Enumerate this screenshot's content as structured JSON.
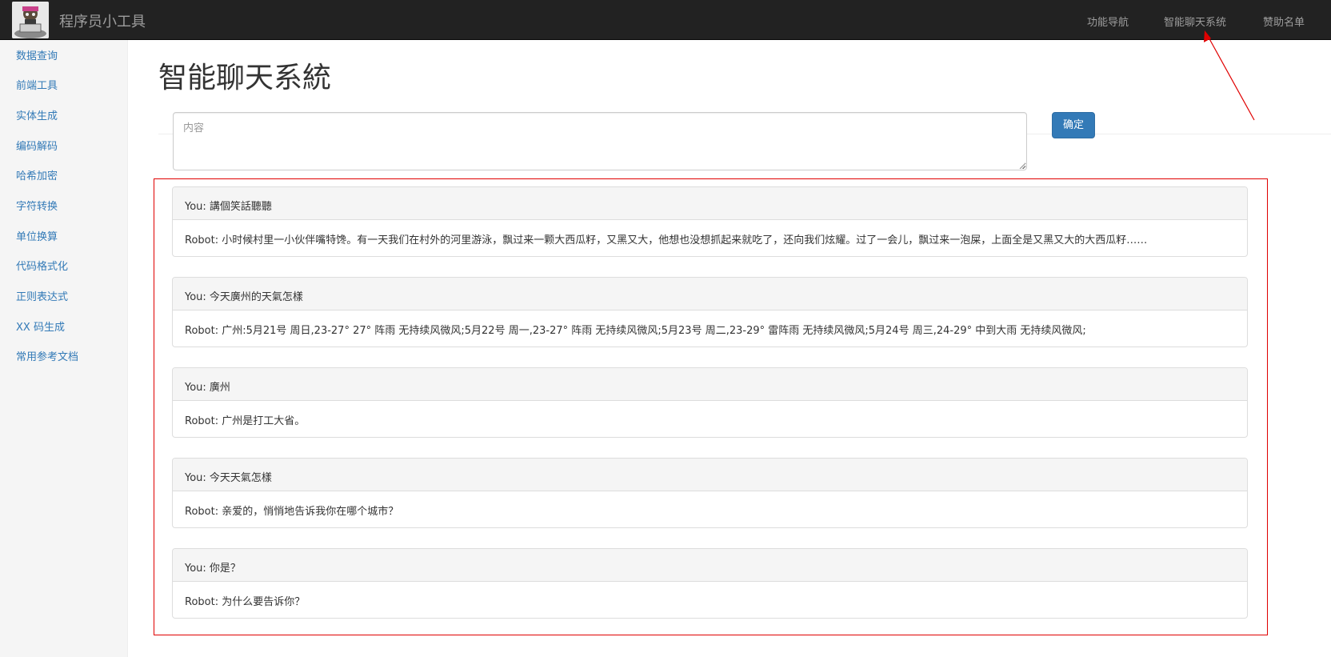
{
  "navbar": {
    "brand": "程序员小工具",
    "links": [
      "功能导航",
      "智能聊天系统",
      "赞助名单"
    ]
  },
  "sidebar": {
    "items": [
      "数据查询",
      "前端工具",
      "实体生成",
      "编码解码",
      "哈希加密",
      "字符转换",
      "单位换算",
      "代码格式化",
      "正则表达式",
      "XX 码生成",
      "常用参考文档"
    ]
  },
  "main": {
    "title": "智能聊天系統",
    "input_placeholder": "内容",
    "submit_label": "确定"
  },
  "chat": [
    {
      "you": "You: 講個笑話聽聽",
      "robot": "Robot: 小时候村里一小伙伴嘴特馋。有一天我们在村外的河里游泳，飘过来一颗大西瓜籽，又黑又大，他想也没想抓起来就吃了，还向我们炫耀。过了一会儿，飘过来一泡屎，上面全是又黑又大的大西瓜籽……"
    },
    {
      "you": "You: 今天廣州的天氣怎樣",
      "robot": "Robot: 广州:5月21号 周日,23-27° 27° 阵雨 无持续风微风;5月22号 周一,23-27° 阵雨 无持续风微风;5月23号 周二,23-29° 雷阵雨 无持续风微风;5月24号 周三,24-29° 中到大雨 无持续风微风;"
    },
    {
      "you": "You: 廣州",
      "robot": "Robot: 广州是打工大省。"
    },
    {
      "you": "You: 今天天氣怎樣",
      "robot": "Robot: 亲爱的，悄悄地告诉我你在哪个城市？"
    },
    {
      "you": "You: 你是？",
      "robot": "Robot: 为什么要告诉你？"
    }
  ],
  "colors": {
    "navbar_bg": "#222222",
    "link": "#337ab7",
    "primary_button": "#337ab7",
    "annotation": "#e00000"
  }
}
